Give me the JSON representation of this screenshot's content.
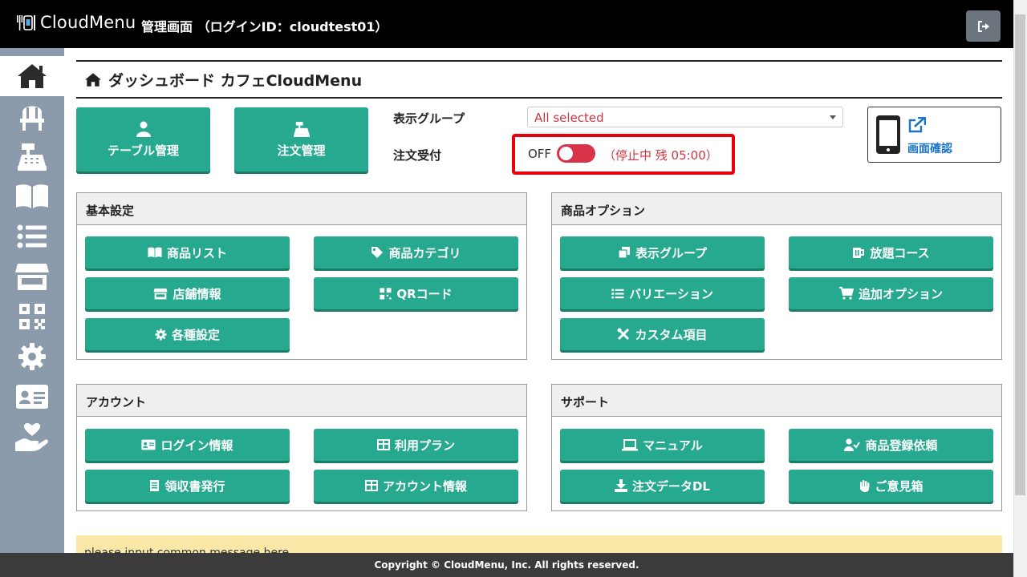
{
  "header": {
    "brand": "CloudMenu",
    "admin_label": "管理画面 （ログインID：cloudtest01）"
  },
  "sidebar": {
    "items": [
      {
        "icon": "home-icon"
      },
      {
        "icon": "chair-icon"
      },
      {
        "icon": "cash-register-icon"
      },
      {
        "icon": "book-icon"
      },
      {
        "icon": "list-icon"
      },
      {
        "icon": "store-icon"
      },
      {
        "icon": "qr-icon"
      },
      {
        "icon": "gear-icon"
      },
      {
        "icon": "id-card-icon"
      },
      {
        "icon": "hand-heart-icon"
      }
    ]
  },
  "page": {
    "title": "ダッシュボード カフェCloudMenu",
    "table_button": "テーブル管理",
    "order_button": "注文管理",
    "display_group_label": "表示グループ",
    "display_group_value": "All selected",
    "order_accept_label": "注文受付",
    "toggle_state": "OFF",
    "stop_status": "（停止中 残 05:00）",
    "preview_label": "画面確認"
  },
  "panels": {
    "basic": {
      "title": "基本設定",
      "buttons": [
        "商品リスト",
        "商品カテゴリ",
        "店舗情報",
        "QRコード",
        "各種設定"
      ]
    },
    "options": {
      "title": "商品オプション",
      "buttons": [
        "表示グループ",
        "放題コース",
        "バリエーション",
        "追加オプション",
        "カスタム項目"
      ]
    },
    "account": {
      "title": "アカウント",
      "buttons": [
        "ログイン情報",
        "利用プラン",
        "領収書発行",
        "アカウント情報"
      ]
    },
    "support": {
      "title": "サポート",
      "buttons": [
        "マニュアル",
        "商品登録依頼",
        "注文データDL",
        "ご意見箱"
      ]
    }
  },
  "notice": "please input common message here",
  "footer": "Copyright © CloudMenu, Inc. All rights reserved.",
  "colors": {
    "accent": "#26a98f",
    "sidebar": "#8c9bac",
    "danger": "#d9334a",
    "link": "#1a73c8"
  }
}
